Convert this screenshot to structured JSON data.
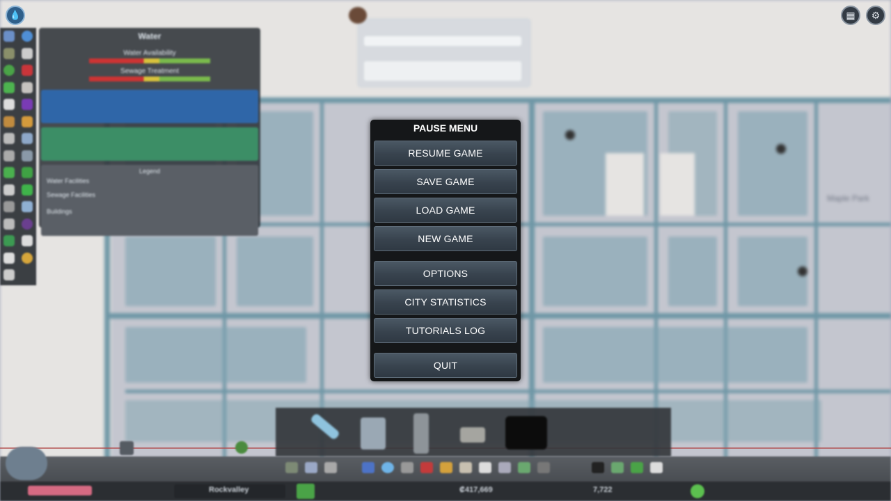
{
  "pause_menu": {
    "title": "PAUSE MENU",
    "buttons": {
      "resume": "RESUME GAME",
      "save": "SAVE GAME",
      "load": "LOAD GAME",
      "new": "NEW GAME",
      "options": "OPTIONS",
      "city_statistics": "CITY STATISTICS",
      "tutorials_log": "TUTORIALS LOG",
      "quit": "QUIT"
    }
  },
  "water_panel": {
    "title": "Water",
    "water_availability_label": "Water Availability",
    "sewage_treatment_label": "Sewage Treatment",
    "legend_title": "Legend",
    "legend_rows": [
      "Water Facilities",
      "Sewage Facilities",
      "Buildings"
    ]
  },
  "map": {
    "district_label": "Maple Park"
  },
  "bottom_bar": {
    "city_name": "Rockvalley",
    "money": "₡417,669",
    "population": "7,722"
  },
  "icons": {
    "top_left": "info-views-icon",
    "top_right": [
      "unlock-icon",
      "settings-gear-icon"
    ]
  },
  "colors": {
    "menu_bg": "#151719",
    "button_bg": "#3b4651",
    "water_blue": "#2f66a8",
    "sewage_green": "#3c8e66"
  }
}
